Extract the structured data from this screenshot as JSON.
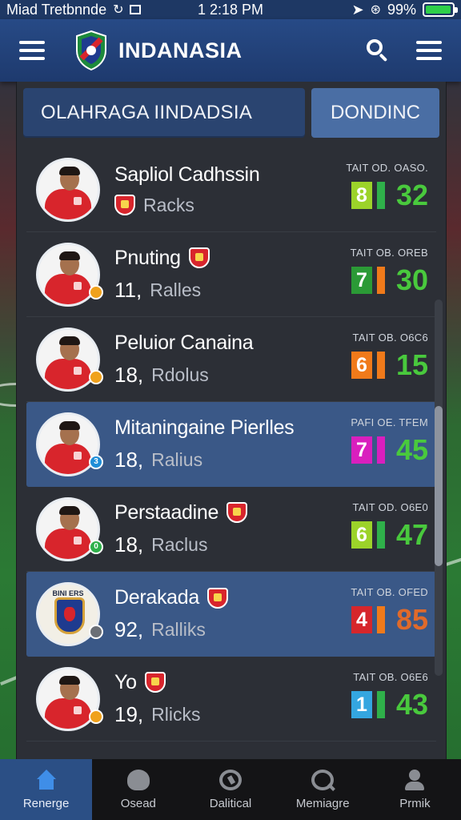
{
  "status_bar": {
    "carrier": "Miad Tretbnnde",
    "time": "1 2:18 PM",
    "battery": "99%",
    "battery_level": 0.99
  },
  "header": {
    "title": "INDANASIA",
    "icons": [
      "menu-icon",
      "logo-icon",
      "search-icon",
      "menu-icon"
    ]
  },
  "tabs": {
    "main": "OLAHRAGA IINDADSIA",
    "side": "DONDINC"
  },
  "players": [
    {
      "name": "Sapliol Cadhssin",
      "number": "",
      "unit": "Racks",
      "stat_label": "TAIT OD. OASO.",
      "left": "8",
      "right": "32",
      "sq_color": "#9cd32a",
      "bar_color": "#2fb04a",
      "big_color": "#49c93d",
      "badge": "",
      "badge_color": ""
    },
    {
      "name": "Pnuting",
      "number": "11,",
      "unit": "Ralles",
      "stat_label": "TAIT OB. OREB",
      "left": "7",
      "right": "30",
      "sq_color": "#2b9a36",
      "bar_color": "#f07a1a",
      "big_color": "#49c93d",
      "badge": "",
      "badge_color": "#f0a11c"
    },
    {
      "name": "Peluior Canaina",
      "number": "18,",
      "unit": "Rdolus",
      "stat_label": "TAIT OB. O6C6",
      "left": "6",
      "right": "15",
      "sq_color": "#f07a1a",
      "bar_color": "#f07a1a",
      "big_color": "#49c93d",
      "badge": "",
      "badge_color": "#f0a11c"
    },
    {
      "name": "Mitaningaine Pierlles",
      "number": "18,",
      "unit": "Ralius",
      "stat_label": "PAFI OE. TFEM",
      "left": "7",
      "right": "45",
      "sq_color": "#d91fbe",
      "bar_color": "#d91fbe",
      "big_color": "#49c93d",
      "badge": "3",
      "badge_color": "#1f8ed8"
    },
    {
      "name": "Perstaadine",
      "number": "18,",
      "unit": "Raclus",
      "stat_label": "TAIT OD. O6E0",
      "left": "6",
      "right": "47",
      "sq_color": "#9cd32a",
      "bar_color": "#2fb04a",
      "big_color": "#49c93d",
      "badge": "0",
      "badge_color": "#2fb04a"
    },
    {
      "name": "Derakada",
      "number": "92,",
      "unit": "Ralliks",
      "stat_label": "TAIT OB. OFED",
      "left": "4",
      "right": "85",
      "sq_color": "#d6262b",
      "bar_color": "#f07a1a",
      "big_color": "#e06a2a",
      "badge": "",
      "badge_color": "#6b6f76",
      "club_label": "BINI ERS"
    },
    {
      "name": "Yo",
      "number": "19,",
      "unit": "Rlicks",
      "stat_label": "TAIT OB. O6E6",
      "left": "1",
      "right": "43",
      "sq_color": "#34a6e0",
      "bar_color": "#2fb04a",
      "big_color": "#49c93d",
      "badge": "",
      "badge_color": "#f0a11c"
    }
  ],
  "nav": [
    {
      "label": "Renerge",
      "icon": "home-icon"
    },
    {
      "label": "Osead",
      "icon": "squad-icon"
    },
    {
      "label": "Dalitical",
      "icon": "stats-icon"
    },
    {
      "label": "Memiagre",
      "icon": "search-icon"
    },
    {
      "label": "Prmik",
      "icon": "profile-icon"
    }
  ]
}
